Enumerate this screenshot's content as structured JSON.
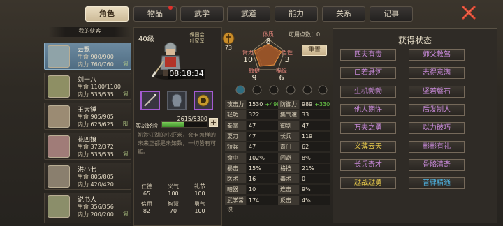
{
  "tabs": [
    {
      "label": "角色",
      "active": true,
      "badge": false
    },
    {
      "label": "物品",
      "active": false,
      "badge": true
    },
    {
      "label": "武学",
      "active": false,
      "badge": false
    },
    {
      "label": "武道",
      "active": false,
      "badge": false
    },
    {
      "label": "能力",
      "active": false,
      "badge": false
    },
    {
      "label": "关系",
      "active": false,
      "badge": false
    },
    {
      "label": "记事",
      "active": false,
      "badge": false
    }
  ],
  "list_title": "我的侠客",
  "characters": [
    {
      "name": "云飘",
      "hp_label": "生命",
      "hp": "900/900",
      "mp_label": "内力",
      "mp": "760/760",
      "tag": "调",
      "selected": true
    },
    {
      "name": "刘十八",
      "hp_label": "生命",
      "hp": "1100/1100",
      "mp_label": "内力",
      "mp": "535/535",
      "tag": "调",
      "selected": false
    },
    {
      "name": "王大锤",
      "hp_label": "生命",
      "hp": "905/905",
      "mp_label": "内力",
      "mp": "625/625",
      "tag": "阳",
      "selected": false
    },
    {
      "name": "花四娘",
      "hp_label": "生命",
      "hp": "372/372",
      "mp_label": "内力",
      "mp": "535/535",
      "tag": "调",
      "selected": false
    },
    {
      "name": "洪小七",
      "hp_label": "生命",
      "hp": "805/805",
      "mp_label": "内力",
      "mp": "420/420",
      "tag": "",
      "selected": false
    },
    {
      "name": "说书人",
      "hp_label": "生命",
      "hp": "356/356",
      "mp_label": "内力",
      "mp": "200/200",
      "tag": "调",
      "selected": false
    }
  ],
  "hero": {
    "level": "40级",
    "guild": "保国会",
    "rank": "叶家军",
    "timer": "08:18:34",
    "exp_label": "实战经验",
    "exp": "2615/5300",
    "exp_fraction": 0.49,
    "profile": "初涉江湖的小虾米，会有怎样的未来正都是未知数，一切皆有可能。"
  },
  "virtues": [
    {
      "k": "仁德",
      "v": "65"
    },
    {
      "k": "义气",
      "v": "100"
    },
    {
      "k": "礼节",
      "v": "100"
    },
    {
      "k": "信用",
      "v": "82"
    },
    {
      "k": "智慧",
      "v": "70"
    },
    {
      "k": "勇气",
      "v": "100"
    }
  ],
  "attrs": {
    "points_label": "可用点数：",
    "points": "0",
    "potential": "73",
    "reset_label": "重置",
    "list": [
      {
        "k": "体质",
        "v": "8"
      },
      {
        "k": "悟性",
        "v": "3"
      },
      {
        "k": "福缘",
        "v": "6"
      },
      {
        "k": "敏捷",
        "v": "9"
      },
      {
        "k": "臂力",
        "v": "10"
      }
    ]
  },
  "stats_left": [
    {
      "k": "攻击力",
      "v": "1530",
      "bonus": "+498"
    },
    {
      "k": "轻功",
      "v": "322",
      "bonus": ""
    },
    {
      "k": "拳掌",
      "v": "47",
      "bonus": ""
    },
    {
      "k": "耍刀",
      "v": "47",
      "bonus": ""
    },
    {
      "k": "短兵",
      "v": "47",
      "bonus": ""
    },
    {
      "k": "命中",
      "v": "102%",
      "bonus": ""
    },
    {
      "k": "暴击",
      "v": "15%",
      "bonus": ""
    },
    {
      "k": "医术",
      "v": "16",
      "bonus": ""
    },
    {
      "k": "暗器",
      "v": "10",
      "bonus": ""
    },
    {
      "k": "武学常识",
      "v": "174",
      "bonus": ""
    }
  ],
  "stats_right": [
    {
      "k": "防御力",
      "v": "989",
      "bonus": "+330"
    },
    {
      "k": "集气速度",
      "v": "33",
      "bonus": ""
    },
    {
      "k": "御剑",
      "v": "47",
      "bonus": ""
    },
    {
      "k": "长兵",
      "v": "119",
      "bonus": ""
    },
    {
      "k": "奇门",
      "v": "62",
      "bonus": ""
    },
    {
      "k": "闪避",
      "v": "8%",
      "bonus": ""
    },
    {
      "k": "格挡",
      "v": "21%",
      "bonus": ""
    },
    {
      "k": "毒术",
      "v": "0",
      "bonus": ""
    },
    {
      "k": "连击",
      "v": "9%",
      "bonus": ""
    },
    {
      "k": "反击",
      "v": "4%",
      "bonus": ""
    }
  ],
  "status": {
    "title": "获得状态",
    "items": [
      {
        "label": "匹夫有责",
        "color": "purple"
      },
      {
        "label": "师父教驾",
        "color": "purple"
      },
      {
        "label": "口若悬河",
        "color": "purple"
      },
      {
        "label": "志得意满",
        "color": "purple"
      },
      {
        "label": "生机勃勃",
        "color": "purple"
      },
      {
        "label": "坚若磐石",
        "color": "purple"
      },
      {
        "label": "他人期许",
        "color": "purple"
      },
      {
        "label": "后发制人",
        "color": "purple"
      },
      {
        "label": "万夫之勇",
        "color": "purple"
      },
      {
        "label": "以力破巧",
        "color": "purple"
      },
      {
        "label": "义薄云天",
        "color": "yellow"
      },
      {
        "label": "彬彬有礼",
        "color": "purple"
      },
      {
        "label": "长兵奇才",
        "color": "purple"
      },
      {
        "label": "骨骼清奇",
        "color": "purple"
      },
      {
        "label": "越战越勇",
        "color": "yellow"
      },
      {
        "label": "音律精通",
        "color": "blue"
      }
    ]
  },
  "colors": {
    "accent_green": "#6bd04a",
    "status_purple": "#c98adb",
    "status_yellow": "#e6c84a",
    "status_blue": "#4eb6e6"
  }
}
